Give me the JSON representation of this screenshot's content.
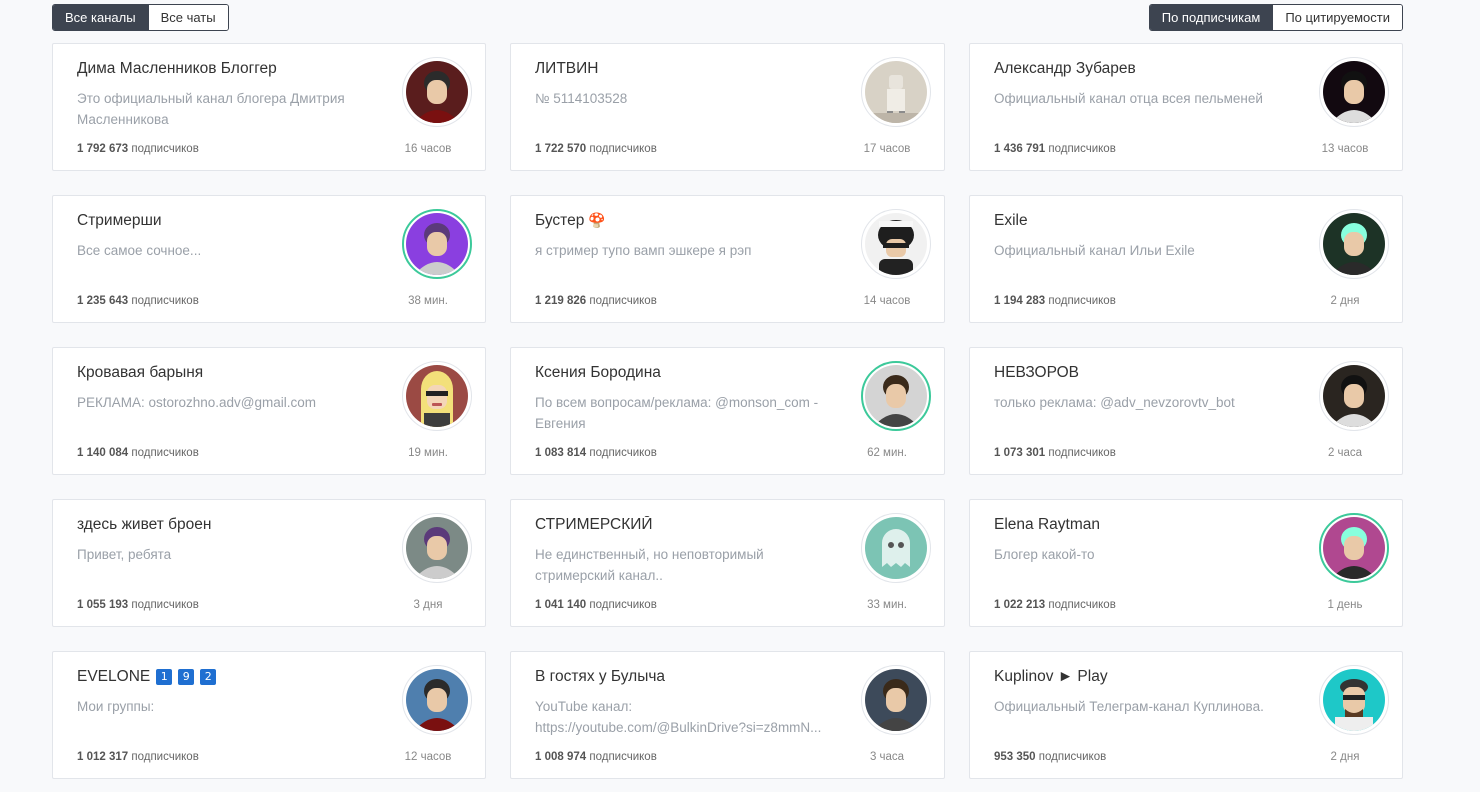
{
  "filters": {
    "all_channels": "Все каналы",
    "all_chats": "Все чаты",
    "by_subscribers": "По подписчикам",
    "by_citation": "По цитируемости"
  },
  "subs_word": "подписчиков",
  "channels": [
    {
      "title": "Дима Масленников Блоггер",
      "desc": "Это официальный канал блогера Дмитрия Масленникова",
      "subs": "1 792 673",
      "time": "16 часов",
      "avatar_bg": "#5a1d1d"
    },
    {
      "title": "ЛИТВИН",
      "desc": "№ 5114103528",
      "subs": "1 722 570",
      "time": "17 часов",
      "avatar_bg": "#d8d2c6"
    },
    {
      "title": "Александр Зубарев",
      "desc": "Официальный канал отца всея пельменей",
      "subs": "1 436 791",
      "time": "13 часов",
      "avatar_bg": "#120910"
    },
    {
      "title": "Стримерши",
      "desc": "Все самое сочное...",
      "subs": "1 235 643",
      "time": "38 мин.",
      "avatar_bg": "#8a3fe0"
    },
    {
      "title": "Бустер",
      "title_emoji": "🍄",
      "desc": "я стример тупо вамп эшкере я рэп",
      "subs": "1 219 826",
      "time": "14 часов",
      "avatar_bg": "#f1f1f1"
    },
    {
      "title": "Exile",
      "desc": "Официальный канал Ильи Exile",
      "subs": "1 194 283",
      "time": "2 дня",
      "avatar_bg": "#1d3326"
    },
    {
      "title": "Кровавая барыня",
      "desc": "РЕКЛАМА: ostorozhno.adv@gmail.com",
      "subs": "1 140 084",
      "time": "19 мин.",
      "avatar_bg": "#9b4a44"
    },
    {
      "title": "Ксения Бородина",
      "desc": "По всем вопросам/реклама: @monson_com - Евгения",
      "subs": "1 083 814",
      "time": "62 мин.",
      "avatar_bg": "#d4d4d4"
    },
    {
      "title": "НЕВЗОРОВ",
      "desc": "только реклама: @adv_nevzorovtv_bot",
      "subs": "1 073 301",
      "time": "2 часа",
      "avatar_bg": "#2a2520"
    },
    {
      "title": "здесь живет броен",
      "desc": "Привет, ребята",
      "subs": "1 055 193",
      "time": "3 дня",
      "avatar_bg": "#7c8a86"
    },
    {
      "title": "СТРИМЕРСКИЙ",
      "desc": "Не единственный, но неповторимый стримерский канал..",
      "subs": "1 041 140",
      "time": "33 мин.",
      "avatar_bg": "#7cc4b4"
    },
    {
      "title": "Elena Raytman",
      "desc": "Блогер какой-то",
      "subs": "1 022 213",
      "time": "1 день",
      "avatar_bg": "#b04890"
    },
    {
      "title": "EVELONE",
      "badges": [
        "1",
        "9",
        "2"
      ],
      "desc": "Мои группы:",
      "subs": "1 012 317",
      "time": "12 часов",
      "avatar_bg": "#4f7fae"
    },
    {
      "title": "В гостях у Булыча",
      "desc": "YouTube канал: https://youtube.com/@BulkinDrive?si=z8mmN...",
      "subs": "1 008 974",
      "time": "3 часа",
      "avatar_bg": "#3d4a5a"
    },
    {
      "title": "Kuplinov ► Play",
      "desc": "Официальный Телеграм-канал Куплинова.",
      "subs": "953 350",
      "time": "2 дня",
      "avatar_bg": "#1ec8c8"
    }
  ]
}
